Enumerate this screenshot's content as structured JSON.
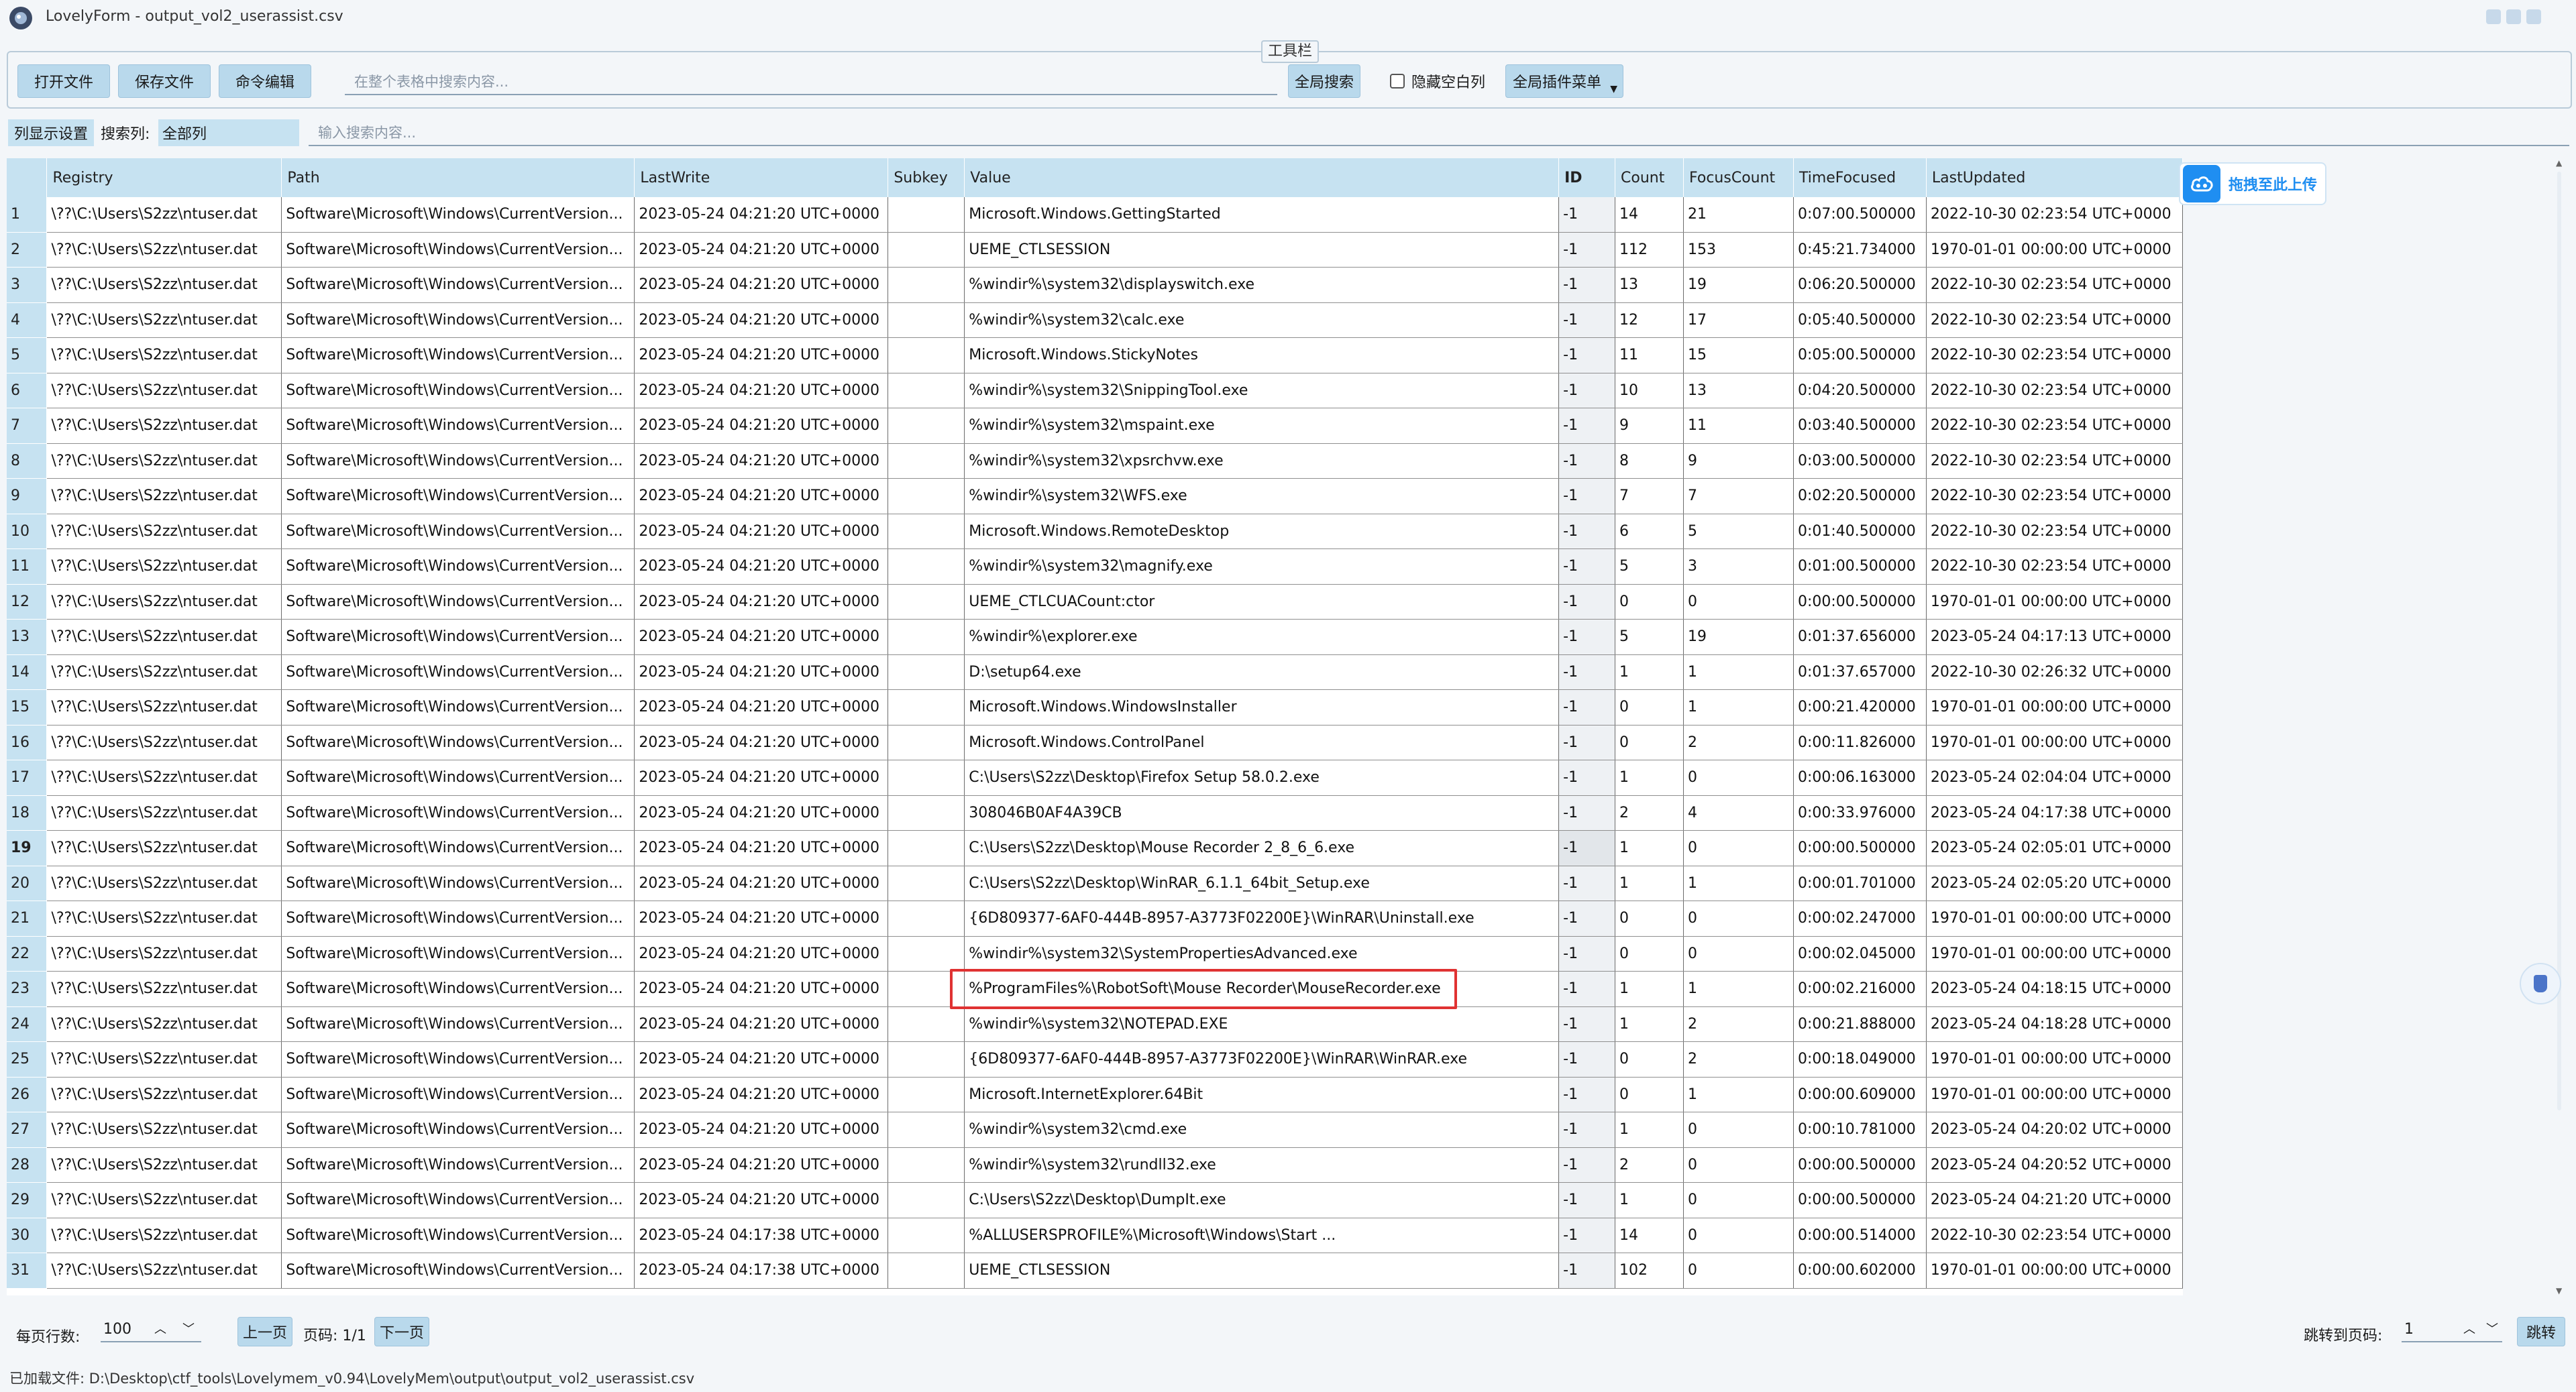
{
  "window": {
    "title": "LovelyForm - output_vol2_userassist.csv",
    "icon": "app-logo-icon"
  },
  "toolbar": {
    "legend": "工具栏",
    "open_file": "打开文件",
    "save_file": "保存文件",
    "command_edit": "命令编辑",
    "search_placeholder": "在整个表格中搜索内容...",
    "global_search": "全局搜索",
    "hide_empty_columns": "隐藏空白列",
    "plugin_menu": "全局插件菜单"
  },
  "filter": {
    "column_display": "列显示设置",
    "search_column_label": "搜索列:",
    "search_column_value": "全部列",
    "search_placeholder": "输入搜索内容..."
  },
  "table": {
    "columns": [
      "Registry",
      "Path",
      "LastWrite",
      "Subkey",
      "Value",
      "ID",
      "Count",
      "FocusCount",
      "TimeFocused",
      "LastUpdated"
    ],
    "rows": [
      [
        "\\??\\C:\\Users\\S2zz\\ntuser.dat",
        "Software\\Microsoft\\Windows\\CurrentVersion...",
        "2023-05-24 04:21:20 UTC+0000",
        "",
        "Microsoft.Windows.GettingStarted",
        "-1",
        "14",
        "21",
        "0:07:00.500000",
        "2022-10-30 02:23:54 UTC+0000"
      ],
      [
        "\\??\\C:\\Users\\S2zz\\ntuser.dat",
        "Software\\Microsoft\\Windows\\CurrentVersion...",
        "2023-05-24 04:21:20 UTC+0000",
        "",
        "UEME_CTLSESSION",
        "-1",
        "112",
        "153",
        "0:45:21.734000",
        "1970-01-01 00:00:00 UTC+0000"
      ],
      [
        "\\??\\C:\\Users\\S2zz\\ntuser.dat",
        "Software\\Microsoft\\Windows\\CurrentVersion...",
        "2023-05-24 04:21:20 UTC+0000",
        "",
        "%windir%\\system32\\displayswitch.exe",
        "-1",
        "13",
        "19",
        "0:06:20.500000",
        "2022-10-30 02:23:54 UTC+0000"
      ],
      [
        "\\??\\C:\\Users\\S2zz\\ntuser.dat",
        "Software\\Microsoft\\Windows\\CurrentVersion...",
        "2023-05-24 04:21:20 UTC+0000",
        "",
        "%windir%\\system32\\calc.exe",
        "-1",
        "12",
        "17",
        "0:05:40.500000",
        "2022-10-30 02:23:54 UTC+0000"
      ],
      [
        "\\??\\C:\\Users\\S2zz\\ntuser.dat",
        "Software\\Microsoft\\Windows\\CurrentVersion...",
        "2023-05-24 04:21:20 UTC+0000",
        "",
        "Microsoft.Windows.StickyNotes",
        "-1",
        "11",
        "15",
        "0:05:00.500000",
        "2022-10-30 02:23:54 UTC+0000"
      ],
      [
        "\\??\\C:\\Users\\S2zz\\ntuser.dat",
        "Software\\Microsoft\\Windows\\CurrentVersion...",
        "2023-05-24 04:21:20 UTC+0000",
        "",
        "%windir%\\system32\\SnippingTool.exe",
        "-1",
        "10",
        "13",
        "0:04:20.500000",
        "2022-10-30 02:23:54 UTC+0000"
      ],
      [
        "\\??\\C:\\Users\\S2zz\\ntuser.dat",
        "Software\\Microsoft\\Windows\\CurrentVersion...",
        "2023-05-24 04:21:20 UTC+0000",
        "",
        "%windir%\\system32\\mspaint.exe",
        "-1",
        "9",
        "11",
        "0:03:40.500000",
        "2022-10-30 02:23:54 UTC+0000"
      ],
      [
        "\\??\\C:\\Users\\S2zz\\ntuser.dat",
        "Software\\Microsoft\\Windows\\CurrentVersion...",
        "2023-05-24 04:21:20 UTC+0000",
        "",
        "%windir%\\system32\\xpsrchvw.exe",
        "-1",
        "8",
        "9",
        "0:03:00.500000",
        "2022-10-30 02:23:54 UTC+0000"
      ],
      [
        "\\??\\C:\\Users\\S2zz\\ntuser.dat",
        "Software\\Microsoft\\Windows\\CurrentVersion...",
        "2023-05-24 04:21:20 UTC+0000",
        "",
        "%windir%\\system32\\WFS.exe",
        "-1",
        "7",
        "7",
        "0:02:20.500000",
        "2022-10-30 02:23:54 UTC+0000"
      ],
      [
        "\\??\\C:\\Users\\S2zz\\ntuser.dat",
        "Software\\Microsoft\\Windows\\CurrentVersion...",
        "2023-05-24 04:21:20 UTC+0000",
        "",
        "Microsoft.Windows.RemoteDesktop",
        "-1",
        "6",
        "5",
        "0:01:40.500000",
        "2022-10-30 02:23:54 UTC+0000"
      ],
      [
        "\\??\\C:\\Users\\S2zz\\ntuser.dat",
        "Software\\Microsoft\\Windows\\CurrentVersion...",
        "2023-05-24 04:21:20 UTC+0000",
        "",
        "%windir%\\system32\\magnify.exe",
        "-1",
        "5",
        "3",
        "0:01:00.500000",
        "2022-10-30 02:23:54 UTC+0000"
      ],
      [
        "\\??\\C:\\Users\\S2zz\\ntuser.dat",
        "Software\\Microsoft\\Windows\\CurrentVersion...",
        "2023-05-24 04:21:20 UTC+0000",
        "",
        "UEME_CTLCUACount:ctor",
        "-1",
        "0",
        "0",
        "0:00:00.500000",
        "1970-01-01 00:00:00 UTC+0000"
      ],
      [
        "\\??\\C:\\Users\\S2zz\\ntuser.dat",
        "Software\\Microsoft\\Windows\\CurrentVersion...",
        "2023-05-24 04:21:20 UTC+0000",
        "",
        "%windir%\\explorer.exe",
        "-1",
        "5",
        "19",
        "0:01:37.656000",
        "2023-05-24 04:17:13 UTC+0000"
      ],
      [
        "\\??\\C:\\Users\\S2zz\\ntuser.dat",
        "Software\\Microsoft\\Windows\\CurrentVersion...",
        "2023-05-24 04:21:20 UTC+0000",
        "",
        "D:\\setup64.exe",
        "-1",
        "1",
        "1",
        "0:01:37.657000",
        "2022-10-30 02:26:32 UTC+0000"
      ],
      [
        "\\??\\C:\\Users\\S2zz\\ntuser.dat",
        "Software\\Microsoft\\Windows\\CurrentVersion...",
        "2023-05-24 04:21:20 UTC+0000",
        "",
        "Microsoft.Windows.WindowsInstaller",
        "-1",
        "0",
        "1",
        "0:00:21.420000",
        "1970-01-01 00:00:00 UTC+0000"
      ],
      [
        "\\??\\C:\\Users\\S2zz\\ntuser.dat",
        "Software\\Microsoft\\Windows\\CurrentVersion...",
        "2023-05-24 04:21:20 UTC+0000",
        "",
        "Microsoft.Windows.ControlPanel",
        "-1",
        "0",
        "2",
        "0:00:11.826000",
        "1970-01-01 00:00:00 UTC+0000"
      ],
      [
        "\\??\\C:\\Users\\S2zz\\ntuser.dat",
        "Software\\Microsoft\\Windows\\CurrentVersion...",
        "2023-05-24 04:21:20 UTC+0000",
        "",
        "C:\\Users\\S2zz\\Desktop\\Firefox Setup 58.0.2.exe",
        "-1",
        "1",
        "0",
        "0:00:06.163000",
        "2023-05-24 02:04:04 UTC+0000"
      ],
      [
        "\\??\\C:\\Users\\S2zz\\ntuser.dat",
        "Software\\Microsoft\\Windows\\CurrentVersion...",
        "2023-05-24 04:21:20 UTC+0000",
        "",
        "308046B0AF4A39CB",
        "-1",
        "2",
        "4",
        "0:00:33.976000",
        "2023-05-24 04:17:38 UTC+0000"
      ],
      [
        "\\??\\C:\\Users\\S2zz\\ntuser.dat",
        "Software\\Microsoft\\Windows\\CurrentVersion...",
        "2023-05-24 04:21:20 UTC+0000",
        "",
        "C:\\Users\\S2zz\\Desktop\\Mouse Recorder 2_8_6_6.exe",
        "-1",
        "1",
        "0",
        "0:00:00.500000",
        "2023-05-24 02:05:01 UTC+0000"
      ],
      [
        "\\??\\C:\\Users\\S2zz\\ntuser.dat",
        "Software\\Microsoft\\Windows\\CurrentVersion...",
        "2023-05-24 04:21:20 UTC+0000",
        "",
        "C:\\Users\\S2zz\\Desktop\\WinRAR_6.1.1_64bit_Setup.exe",
        "-1",
        "1",
        "1",
        "0:00:01.701000",
        "2023-05-24 02:05:20 UTC+0000"
      ],
      [
        "\\??\\C:\\Users\\S2zz\\ntuser.dat",
        "Software\\Microsoft\\Windows\\CurrentVersion...",
        "2023-05-24 04:21:20 UTC+0000",
        "",
        "{6D809377-6AF0-444B-8957-A3773F02200E}\\WinRAR\\Uninstall.exe",
        "-1",
        "0",
        "0",
        "0:00:02.247000",
        "1970-01-01 00:00:00 UTC+0000"
      ],
      [
        "\\??\\C:\\Users\\S2zz\\ntuser.dat",
        "Software\\Microsoft\\Windows\\CurrentVersion...",
        "2023-05-24 04:21:20 UTC+0000",
        "",
        "%windir%\\system32\\SystemPropertiesAdvanced.exe",
        "-1",
        "0",
        "0",
        "0:00:02.045000",
        "1970-01-01 00:00:00 UTC+0000"
      ],
      [
        "\\??\\C:\\Users\\S2zz\\ntuser.dat",
        "Software\\Microsoft\\Windows\\CurrentVersion...",
        "2023-05-24 04:21:20 UTC+0000",
        "",
        "%ProgramFiles%\\RobotSoft\\Mouse Recorder\\MouseRecorder.exe",
        "-1",
        "1",
        "1",
        "0:00:02.216000",
        "2023-05-24 04:18:15 UTC+0000"
      ],
      [
        "\\??\\C:\\Users\\S2zz\\ntuser.dat",
        "Software\\Microsoft\\Windows\\CurrentVersion...",
        "2023-05-24 04:21:20 UTC+0000",
        "",
        "%windir%\\system32\\NOTEPAD.EXE",
        "-1",
        "1",
        "2",
        "0:00:21.888000",
        "2023-05-24 04:18:28 UTC+0000"
      ],
      [
        "\\??\\C:\\Users\\S2zz\\ntuser.dat",
        "Software\\Microsoft\\Windows\\CurrentVersion...",
        "2023-05-24 04:21:20 UTC+0000",
        "",
        "{6D809377-6AF0-444B-8957-A3773F02200E}\\WinRAR\\WinRAR.exe",
        "-1",
        "0",
        "2",
        "0:00:18.049000",
        "1970-01-01 00:00:00 UTC+0000"
      ],
      [
        "\\??\\C:\\Users\\S2zz\\ntuser.dat",
        "Software\\Microsoft\\Windows\\CurrentVersion...",
        "2023-05-24 04:21:20 UTC+0000",
        "",
        "Microsoft.InternetExplorer.64Bit",
        "-1",
        "0",
        "1",
        "0:00:00.609000",
        "1970-01-01 00:00:00 UTC+0000"
      ],
      [
        "\\??\\C:\\Users\\S2zz\\ntuser.dat",
        "Software\\Microsoft\\Windows\\CurrentVersion...",
        "2023-05-24 04:21:20 UTC+0000",
        "",
        "%windir%\\system32\\cmd.exe",
        "-1",
        "1",
        "0",
        "0:00:10.781000",
        "2023-05-24 04:20:02 UTC+0000"
      ],
      [
        "\\??\\C:\\Users\\S2zz\\ntuser.dat",
        "Software\\Microsoft\\Windows\\CurrentVersion...",
        "2023-05-24 04:21:20 UTC+0000",
        "",
        "%windir%\\system32\\rundll32.exe",
        "-1",
        "2",
        "0",
        "0:00:00.500000",
        "2023-05-24 04:20:52 UTC+0000"
      ],
      [
        "\\??\\C:\\Users\\S2zz\\ntuser.dat",
        "Software\\Microsoft\\Windows\\CurrentVersion...",
        "2023-05-24 04:21:20 UTC+0000",
        "",
        "C:\\Users\\S2zz\\Desktop\\DumpIt.exe",
        "-1",
        "1",
        "0",
        "0:00:00.500000",
        "2023-05-24 04:21:20 UTC+0000"
      ],
      [
        "\\??\\C:\\Users\\S2zz\\ntuser.dat",
        "Software\\Microsoft\\Windows\\CurrentVersion...",
        "2023-05-24 04:17:38 UTC+0000",
        "",
        "%ALLUSERSPROFILE%\\Microsoft\\Windows\\Start ...",
        "-1",
        "14",
        "0",
        "0:00:00.514000",
        "2022-10-30 02:23:54 UTC+0000"
      ],
      [
        "\\??\\C:\\Users\\S2zz\\ntuser.dat",
        "Software\\Microsoft\\Windows\\CurrentVersion...",
        "2023-05-24 04:17:38 UTC+0000",
        "",
        "UEME_CTLSESSION",
        "-1",
        "102",
        "0",
        "0:00:00.602000",
        "1970-01-01 00:00:00 UTC+0000"
      ]
    ],
    "selected_row": 19,
    "highlighted_row": 23
  },
  "upload": {
    "label": "拖拽至此上传",
    "icon": "cloud-upload-icon"
  },
  "pager": {
    "rows_per_page_label": "每页行数:",
    "rows_per_page_value": "100",
    "prev": "上一页",
    "page_info": "页码: 1/1",
    "next": "下一页",
    "goto_label": "跳转到页码:",
    "goto_value": "1",
    "goto_button": "跳转"
  },
  "status": {
    "loaded_file": "已加载文件: D:\\Desktop\\ctf_tools\\Lovelymem_v0.94\\LovelyMem\\output\\output_vol2_userassist.csv"
  },
  "colors": {
    "accent": "#1f8ef1",
    "header_bg": "#c6e2f1",
    "button_bg": "#b9d9ec",
    "highlight": "#e03232"
  }
}
